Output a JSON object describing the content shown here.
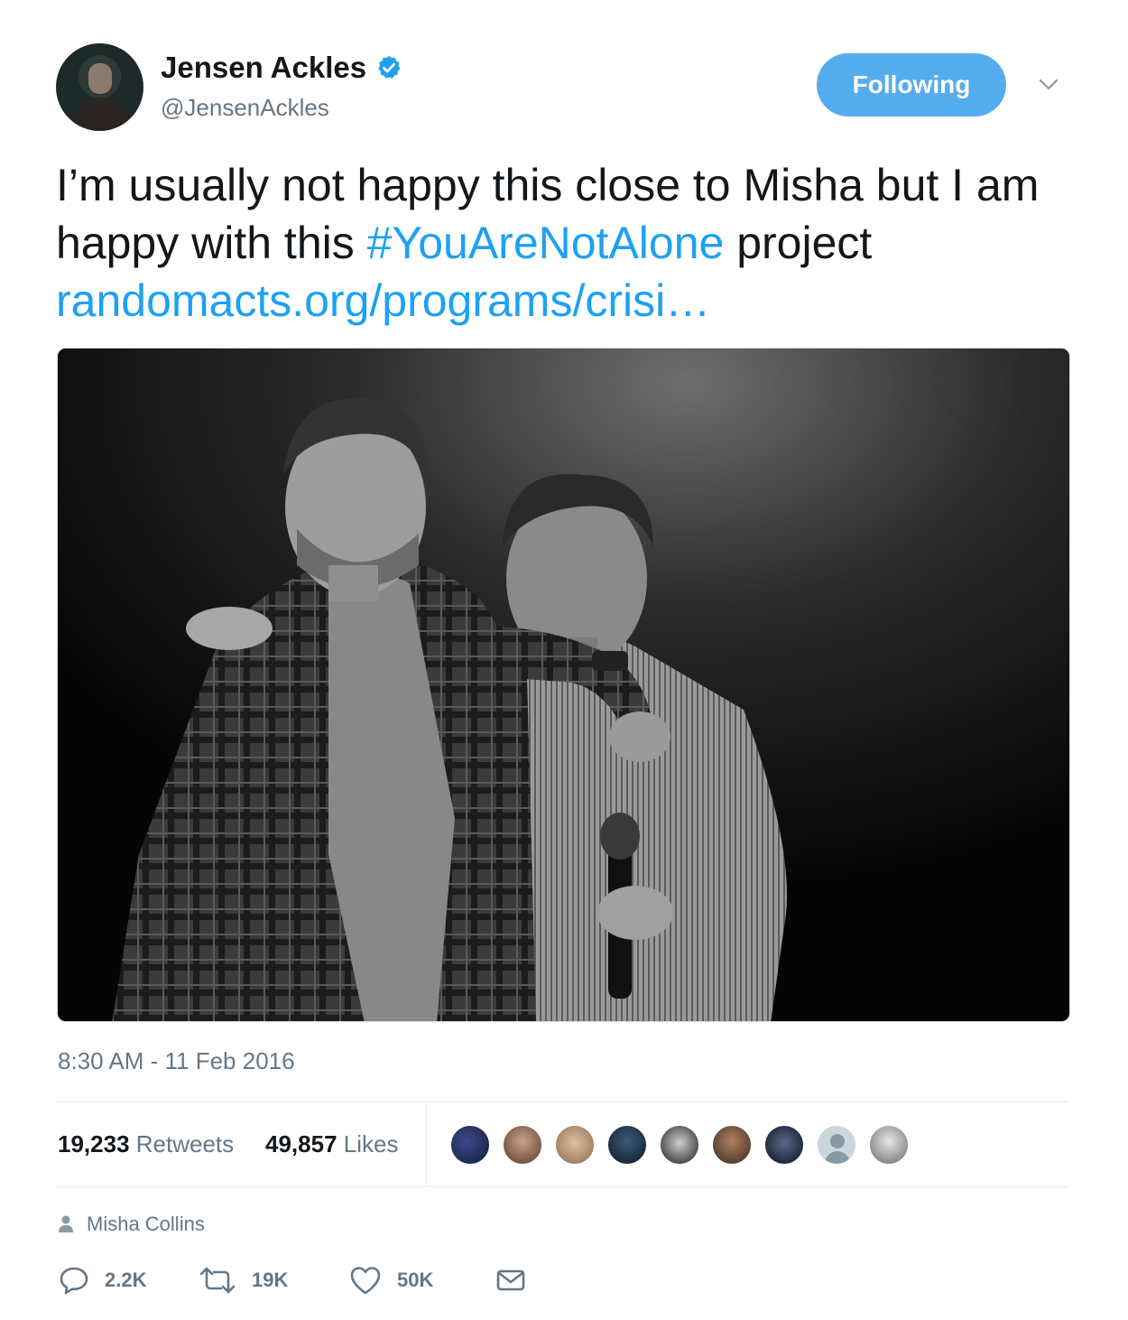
{
  "author": {
    "name": "Jensen Ackles",
    "handle": "@JensenAckles",
    "verified": true
  },
  "follow_button": {
    "label": "Following",
    "color": "#55acee"
  },
  "tweet": {
    "text_part1": "I’m usually not happy this close to Misha but I am happy with this ",
    "hashtag": "#YouAreNotAlone",
    "text_part2": " project ",
    "link": "randomacts.org/programs/crisi…",
    "link_color": "#1da1f2"
  },
  "media": {
    "description_icon": "photo"
  },
  "timestamp": "8:30 AM - 11 Feb 2016",
  "stats": {
    "retweets_count": "19,233",
    "retweets_label": "Retweets",
    "likes_count": "49,857",
    "likes_label": "Likes",
    "liker_avatars": 9
  },
  "context": {
    "icon": "person-icon",
    "text": "Misha Collins"
  },
  "actions": {
    "reply_count": "2.2K",
    "retweet_count": "19K",
    "like_count": "50K"
  }
}
